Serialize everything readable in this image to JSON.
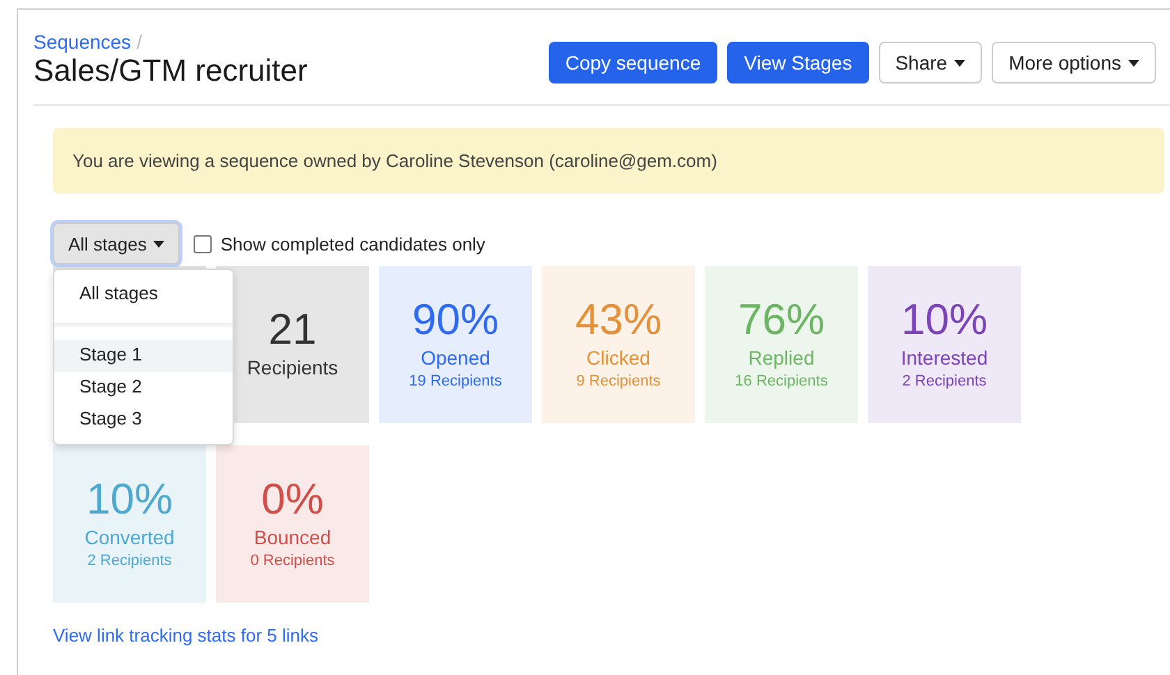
{
  "breadcrumb": {
    "link": "Sequences",
    "separator": "/"
  },
  "title": "Sales/GTM recruiter",
  "actions": [
    {
      "label": "Copy sequence",
      "kind": "primary"
    },
    {
      "label": "View Stages",
      "kind": "primary"
    },
    {
      "label": "Share",
      "kind": "menu"
    },
    {
      "label": "More options",
      "kind": "menu"
    }
  ],
  "alert": "You are viewing a sequence owned by Caroline Stevenson (caroline@gem.com)",
  "filter": {
    "label": "All stages",
    "expanded": true,
    "options": [
      {
        "kind": "option",
        "label": "All stages",
        "selected": false
      },
      {
        "kind": "divider"
      },
      {
        "kind": "option",
        "label": "Stage 1",
        "selected": true
      },
      {
        "kind": "option",
        "label": "Stage 2",
        "selected": false
      },
      {
        "kind": "option",
        "label": "Stage 3",
        "selected": false
      }
    ]
  },
  "completed_only": {
    "label": "Show completed candidates only",
    "checked": false
  },
  "stats": [
    {
      "color": "#e3e3e3"
    },
    {
      "value": "21",
      "label": "Recipients",
      "color": "#333333"
    },
    {
      "value": "90%",
      "label": "Opened",
      "sub": "19 Recipients",
      "color": "#2f6bf0"
    },
    {
      "value": "43%",
      "label": "Clicked",
      "sub": "9 Recipients",
      "color": "#e3913a"
    },
    {
      "value": "76%",
      "label": "Replied",
      "sub": "16 Recipients",
      "color": "#6db565"
    },
    {
      "value": "10%",
      "label": "Interested",
      "sub": "2 Recipients",
      "color": "#7d43b8"
    },
    {
      "value": "10%",
      "label": "Converted",
      "sub": "2 Recipients",
      "color": "#4ea8cf"
    },
    {
      "value": "0%",
      "label": "Bounced",
      "sub": "0 Recipients",
      "color": "#cf504a"
    }
  ],
  "link_stats": "View link tracking stats for 5 links"
}
